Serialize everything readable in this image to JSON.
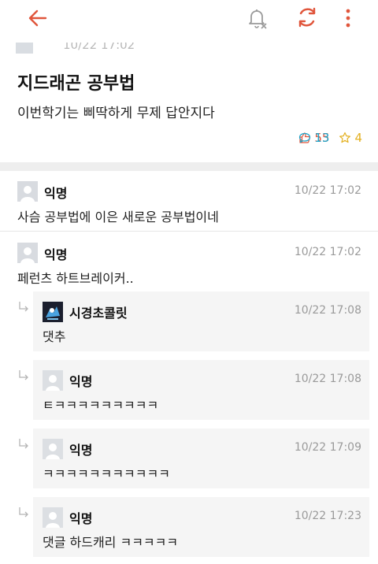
{
  "colors": {
    "accent": "#e0553b",
    "comment": "#1aa3c9",
    "scrap": "#e3b020",
    "separator": "#eeeeee",
    "reply_bg": "#f5f5f5"
  },
  "toolbar": {
    "back_icon": "back-arrow-icon",
    "notify_icon": "bell-off-icon",
    "refresh_icon": "refresh-icon",
    "more_icon": "more-vertical-icon"
  },
  "post": {
    "date": "10/22 17:02",
    "title": "지드래곤 공부법",
    "body": "이번학기는 삐딱하게 무제 답안지다",
    "likes": "55",
    "comments": "13",
    "scraps": "4"
  },
  "comments": [
    {
      "name": "익명",
      "time": "10/22 17:02",
      "text": "사슴 공부법에 이은 새로운 공부법이네"
    },
    {
      "name": "익명",
      "time": "10/22 17:02",
      "text": "페런츠 하트브레이커..",
      "replies": [
        {
          "name": "시경초콜릿",
          "time": "10/22 17:08",
          "text": "댓추"
        },
        {
          "name": "익명",
          "time": "10/22 17:08",
          "text": "ㅌㅋㅋㅋㅋㅋㅋㅋㅋㅋ"
        },
        {
          "name": "익명",
          "time": "10/22 17:09",
          "text": "ㅋㅋㅋㅋㅋㅋㅋㅋㅋㅋㅋ"
        },
        {
          "name": "익명",
          "time": "10/22 17:23",
          "text": "댓글 하드캐리 ㅋㅋㅋㅋㅋ"
        }
      ]
    }
  ]
}
